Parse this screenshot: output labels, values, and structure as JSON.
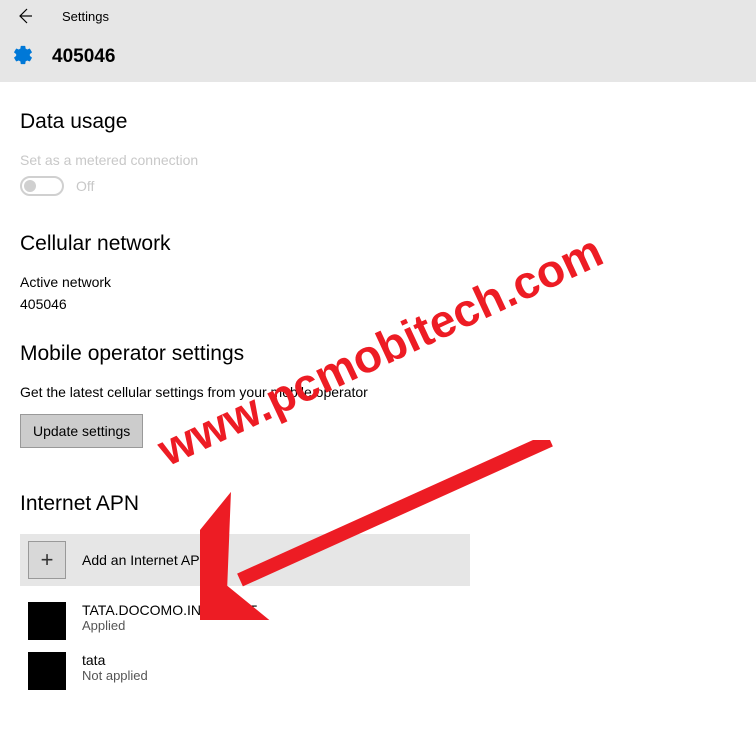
{
  "header": {
    "title": "Settings",
    "networkId": "405046"
  },
  "dataUsage": {
    "title": "Data usage",
    "meteredLabel": "Set as a metered connection",
    "toggleState": "Off"
  },
  "cellularNetwork": {
    "title": "Cellular network",
    "activeNetworkLabel": "Active network",
    "activeNetworkValue": "405046"
  },
  "operatorSettings": {
    "title": "Mobile operator settings",
    "description": "Get the latest cellular settings from your mobile operator",
    "updateButton": "Update settings"
  },
  "internetApn": {
    "title": "Internet APN",
    "addLabel": "Add an Internet APN",
    "items": [
      {
        "name": "TATA.DOCOMO.INTERNET",
        "status": "Applied"
      },
      {
        "name": "tata",
        "status": "Not applied"
      }
    ]
  },
  "watermark": "www.pcmobitech.com"
}
